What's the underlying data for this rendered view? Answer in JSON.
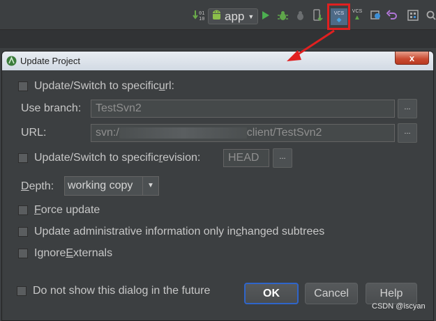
{
  "toolbar": {
    "run_config_label": "app",
    "vcs_label": "VCS",
    "vcs_commit_label": "VCS"
  },
  "dialog": {
    "title": "Update Project",
    "close_label": "x",
    "switch_url": {
      "before": "Update/Switch to specific ",
      "mnemonic": "u",
      "after": "rl:",
      "checked": false
    },
    "branch_label": "Use branch:",
    "branch_value": "TestSvn2",
    "url_label": "URL:",
    "url_value_prefix": "svn:/",
    "url_value_suffix": "client/TestSvn2",
    "browse_label": "...",
    "switch_revision": {
      "before": "Update/Switch to specific ",
      "mnemonic": "r",
      "after": "evision:",
      "checked": false
    },
    "revision_value": "HEAD",
    "depth_label": {
      "mnemonic": "D",
      "after": "epth:"
    },
    "depth_value": "working copy",
    "force_update": {
      "mnemonic": "F",
      "after": "orce update",
      "checked": false
    },
    "admin_info": {
      "before": "Update administrative information only in ",
      "mnemonic": "c",
      "after": "hanged subtrees",
      "checked": false
    },
    "ignore_externals": {
      "before": "Ignore ",
      "mnemonic": "E",
      "after": "xternals",
      "checked": false
    },
    "do_not_show": {
      "label": "Do not show this dialog in the future",
      "checked": false
    },
    "ok_label": "OK",
    "cancel_label": "Cancel",
    "help_label": "Help"
  },
  "watermark": "CSDN @iscyan",
  "colors": {
    "annotation_red": "#e02020",
    "ok_border": "#2f65ca"
  }
}
